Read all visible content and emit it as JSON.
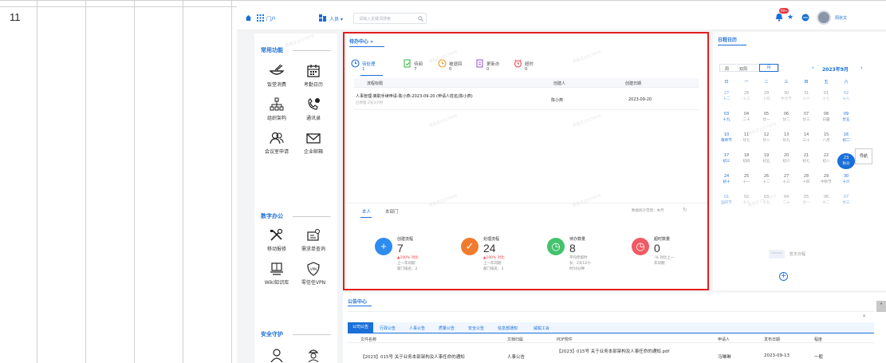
{
  "row_number": "11",
  "topbar": {
    "portal_label": "门户",
    "people_label": "人员",
    "search_placeholder": "请输入关键词搜索",
    "badge_count": "99+",
    "user_name": "周张文"
  },
  "left_panel": {
    "sections": [
      {
        "title": "常用功能",
        "apps": [
          {
            "label": "饭堂消费",
            "icon": "food-bowl-icon"
          },
          {
            "label": "考勤日历",
            "icon": "attendance-calendar-icon"
          },
          {
            "label": "组织架构",
            "icon": "org-structure-icon"
          },
          {
            "label": "通讯录",
            "icon": "phone-book-icon"
          },
          {
            "label": "会议室申请",
            "icon": "meeting-room-icon"
          },
          {
            "label": "企业邮箱",
            "icon": "mail-icon"
          }
        ]
      },
      {
        "title": "数字办公",
        "apps": [
          {
            "label": "移动报修",
            "icon": "repair-tools-icon"
          },
          {
            "label": "需求单查询",
            "icon": "request-query-icon"
          },
          {
            "label": "Wiki知识库",
            "icon": "wiki-book-icon"
          },
          {
            "label": "零信任VPN",
            "icon": "vpn-shield-icon"
          }
        ]
      },
      {
        "title": "安全守护",
        "apps": [
          {
            "label": "",
            "icon": "security-guard-icon"
          },
          {
            "label": "",
            "icon": "safety-officer-icon"
          }
        ]
      }
    ]
  },
  "todo": {
    "title": "待办中心",
    "collapse_glyph": "«",
    "tabs": [
      {
        "label": "待处理",
        "count": "1",
        "color": "#1a6fd8"
      },
      {
        "label": "待阅",
        "count": "7",
        "color": "#43b84a"
      },
      {
        "label": "被退回",
        "count": "0",
        "color": "#f29a22"
      },
      {
        "label": "更新办",
        "count": "0",
        "color": "#9c5fd6"
      },
      {
        "label": "超时",
        "count": "0",
        "color": "#e5454b"
      }
    ],
    "columns": [
      "流程标题",
      "创建人",
      "创建日期"
    ],
    "rows": [
      {
        "title": "人事管理-离职手续申请-陈小燕-2023-09-20 (申请人姓名|陈小燕)",
        "sub": "已停留 2天3小时",
        "creator": "陈小燕",
        "date": "2023-09-20"
      }
    ]
  },
  "stats": {
    "scope_tabs": [
      "本人",
      "本部门"
    ],
    "range_label": "数据统计范围：本月",
    "cards": [
      {
        "title": "创建流程",
        "value": "7",
        "glyph": "+",
        "color": "#2d8cf0",
        "lines": [
          "▲100% 对比",
          "上一年同期",
          "部门排名：2"
        ]
      },
      {
        "title": "处理流程",
        "value": "24",
        "glyph": "✓",
        "color": "#f07b2e",
        "lines": [
          "▲100% 对比",
          "上一年同期",
          "部门排名：3"
        ]
      },
      {
        "title": "待办数量",
        "value": "8",
        "glyph": "◷",
        "color": "#43c36c",
        "lines": [
          "平均停留时",
          "长：2天12小",
          "时50分钟"
        ]
      },
      {
        "title": "超时数量",
        "value": "0",
        "glyph": "◷",
        "color": "#ef5a64",
        "lines": [
          "-% 对比上一",
          "年同期"
        ]
      }
    ]
  },
  "calendar": {
    "title": "日程日历",
    "view_tabs": [
      "周",
      "双周",
      "月"
    ],
    "month_label": "2023年9月",
    "weekdays": [
      "日",
      "一",
      "二",
      "三",
      "四",
      "五",
      "六"
    ],
    "weeks": [
      [
        [
          "27",
          "十二"
        ],
        [
          "28",
          "十三"
        ],
        [
          "29",
          "十四"
        ],
        [
          "30",
          "中元节"
        ],
        [
          "31",
          "十六"
        ],
        [
          "01",
          "十七"
        ],
        [
          "02",
          "十八"
        ]
      ],
      [
        [
          "03",
          "十九"
        ],
        [
          "04",
          "二十"
        ],
        [
          "05",
          "廿一"
        ],
        [
          "06",
          "廿二"
        ],
        [
          "07",
          "廿三"
        ],
        [
          "08",
          "白露"
        ],
        [
          "09",
          "廿五"
        ]
      ],
      [
        [
          "10",
          "教师节"
        ],
        [
          "11",
          "廿七"
        ],
        [
          "12",
          "廿八"
        ],
        [
          "13",
          "廿九"
        ],
        [
          "14",
          "三十"
        ],
        [
          "15",
          "八月"
        ],
        [
          "16",
          "初二"
        ]
      ],
      [
        [
          "17",
          "初三"
        ],
        [
          "18",
          "初四"
        ],
        [
          "19",
          "初五"
        ],
        [
          "20",
          "初六"
        ],
        [
          "21",
          "初七"
        ],
        [
          "22",
          "初八"
        ],
        [
          "23",
          "秋分"
        ]
      ],
      [
        [
          "24",
          "初十"
        ],
        [
          "25",
          "十一"
        ],
        [
          "26",
          "十二"
        ],
        [
          "27",
          "十三"
        ],
        [
          "28",
          "十四"
        ],
        [
          "29",
          "中秋节"
        ],
        [
          "30",
          "十六"
        ]
      ],
      [
        [
          "01",
          "国庆节"
        ],
        [
          "02",
          "十八"
        ],
        [
          "03",
          "十九"
        ],
        [
          "04",
          "二十"
        ],
        [
          "05",
          "廿一"
        ],
        [
          "06",
          "廿二"
        ],
        [
          "07",
          "廿三"
        ]
      ]
    ],
    "empty_label": "暂无日程",
    "nav_label": "导航"
  },
  "notice": {
    "title": "公告中心",
    "tabs": [
      "公司公告",
      "行政公告",
      "人事公告",
      "质量公告",
      "安全公告",
      "信息部通知",
      "威锐工会"
    ],
    "columns": [
      "文件名称",
      "文档归属",
      "PDF附件",
      "申请人",
      "发布日期",
      "程度"
    ],
    "rows": [
      [
        "【2023】015号 关于业务本部架构及人事任命的通知",
        "人事公告",
        "【2023】015号 关于业务本部架构及人事任命的通知.pdf",
        "马琳琳",
        "2023-09-13",
        "一般"
      ]
    ]
  },
  "watermark": "周张文2017979"
}
